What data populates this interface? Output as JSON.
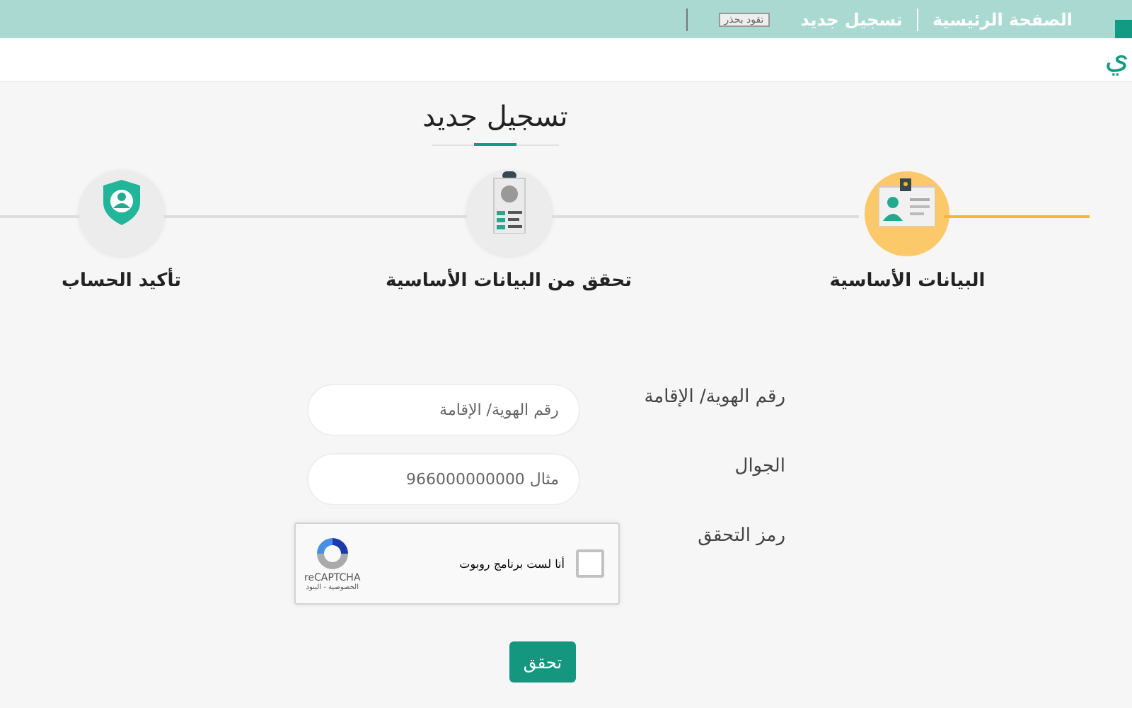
{
  "header": {
    "breadcrumb": [
      {
        "label": "الصفحة الرئيسية"
      },
      {
        "label": "تسجيل جديد"
      }
    ],
    "badge": "تقود بحذر",
    "logo_fragment": "ي"
  },
  "page_title": "تسجيل جديد",
  "steps": [
    {
      "label": "البيانات الأساسية",
      "selected": true
    },
    {
      "label": "تحقق من البيانات الأساسية",
      "selected": false
    },
    {
      "label": "تأكيد الحساب",
      "selected": false
    }
  ],
  "form": {
    "fields": [
      {
        "kind": "text",
        "label": "رقم الهوية/ الإقامة",
        "placeholder": "رقم الهوية/ الإقامة"
      },
      {
        "kind": "text",
        "label": "الجوال",
        "placeholder": "مثال 966000000000"
      },
      {
        "kind": "captcha",
        "label": "رمز التحقق",
        "text": "أنا لست برنامج روبوت",
        "checked": false,
        "brand": "reCAPTCHA",
        "links": "الخصوصية - البنود"
      }
    ],
    "submit": "تحقق"
  }
}
